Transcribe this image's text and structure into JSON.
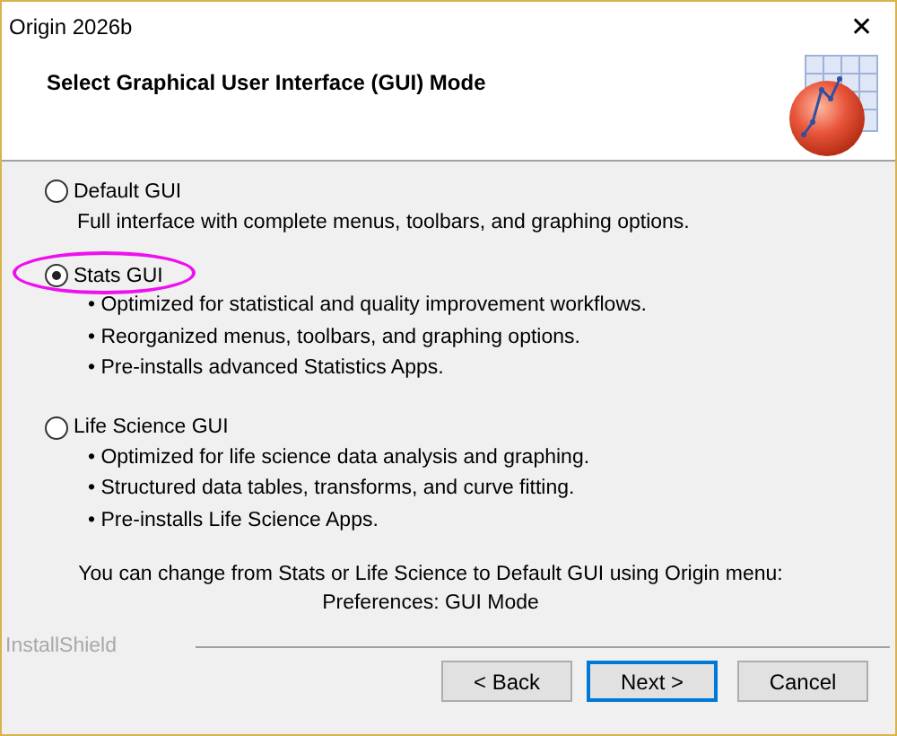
{
  "window": {
    "title": "Origin 2026b",
    "close": "✕"
  },
  "header": {
    "title": "Select Graphical User Interface (GUI) Mode"
  },
  "options": [
    {
      "label": "Default GUI",
      "selected": false,
      "highlighted": false,
      "description": "Full interface with complete menus, toolbars, and graphing options."
    },
    {
      "label": "Stats GUI",
      "selected": true,
      "highlighted": true,
      "bullets": [
        "• Optimized for statistical and quality improvement workflows.",
        "• Reorganized menus, toolbars, and graphing options.",
        "• Pre-installs advanced Statistics Apps."
      ]
    },
    {
      "label": "Life Science GUI",
      "selected": false,
      "highlighted": false,
      "bullets": [
        "• Optimized for life science data analysis and graphing.",
        "• Structured data tables, transforms, and curve fitting.",
        "• Pre-installs Life Science Apps."
      ]
    }
  ],
  "note": [
    "You can change from Stats or Life Science to Default GUI using Origin menu:",
    "Preferences: GUI Mode"
  ],
  "brand": "InstallShield",
  "buttons": [
    {
      "label": "< Back",
      "default": false
    },
    {
      "label": "Next >",
      "default": true
    },
    {
      "label": "Cancel",
      "default": false
    }
  ]
}
